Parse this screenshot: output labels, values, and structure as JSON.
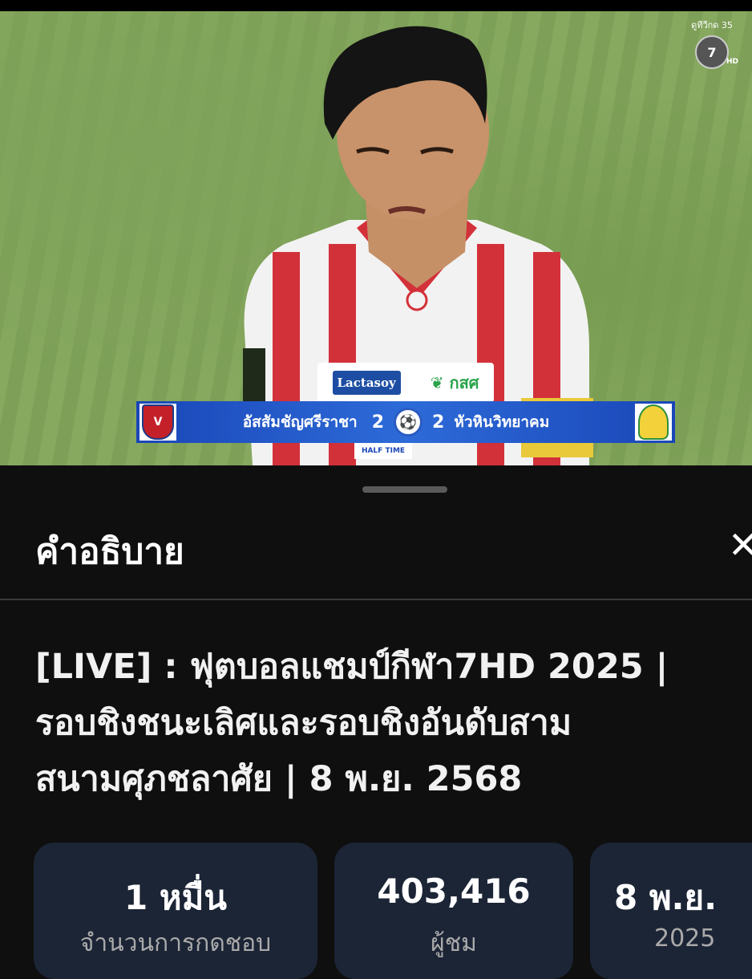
{
  "video": {
    "channel_caption": "ดูทีวีกด 35",
    "channel_number": "7",
    "channel_hd": "HD",
    "sponsor_lactasoy": "Lactasoy",
    "sponsor_gsk": "กสศ",
    "scoreboard": {
      "home_team": "อัสสัมชัญศรีราชา",
      "home_score": "2",
      "away_score": "2",
      "away_team": "หัวหินวิทยาคม",
      "status": "HALF TIME",
      "home_crest_text": "V"
    }
  },
  "panel": {
    "title": "คำอธิบาย",
    "close_label": "✕",
    "video_title": "[LIVE] : ฟุตบอลแชมป์กีฬา7HD 2025 |\nรอบชิงชนะเลิศและรอบชิงอันดับสาม\nสนามศุภชลาศัย | 8 พ.ย. 2568"
  },
  "stats": [
    {
      "value": "1 หมื่น",
      "label": "จำนวนการกดชอบ"
    },
    {
      "value": "403,416",
      "label": "ผู้ชม"
    },
    {
      "value": "8 พ.ย.",
      "label": "2025"
    }
  ],
  "colors": {
    "background": "#0f0f0f",
    "stat_card": "#1c2536",
    "scoreboard_blue": "#1a46b8"
  }
}
